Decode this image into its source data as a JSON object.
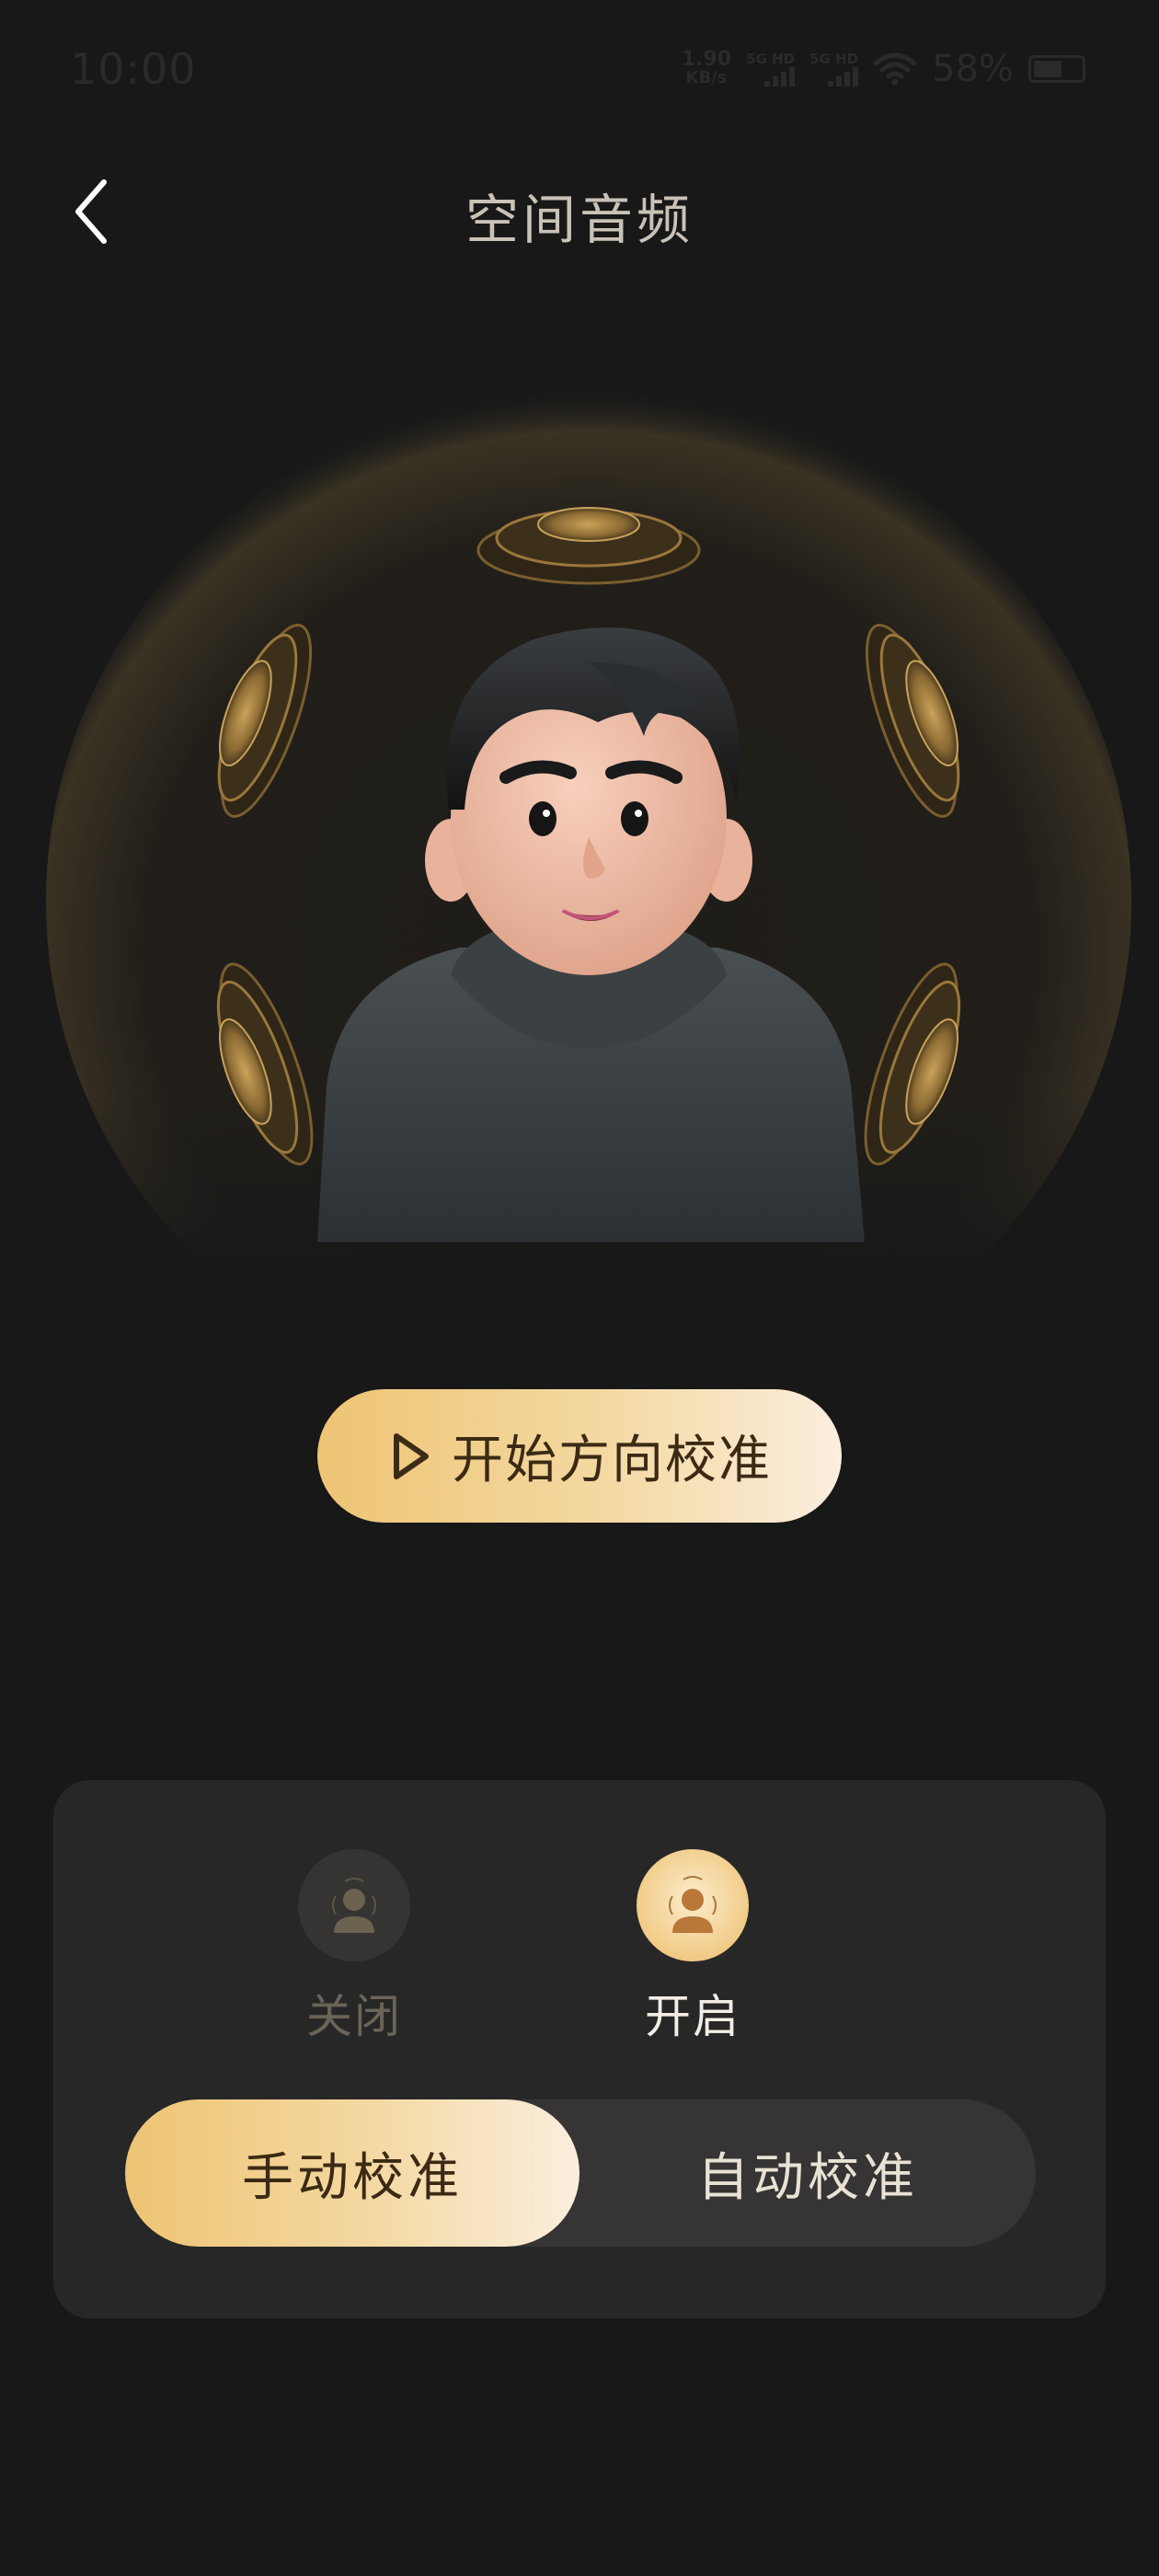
{
  "status_bar": {
    "time": "10:00",
    "net_speed_value": "1.90",
    "net_speed_unit": "KB/s",
    "signal1_label": "5G HD",
    "signal2_label": "5G HD",
    "battery_percent": "58%"
  },
  "header": {
    "title": "空间音频",
    "back_icon": "chevron-left-icon"
  },
  "hero": {
    "image": "avatar-with-surround-sound-waves"
  },
  "calibrate_button": {
    "label": "开始方向校准",
    "icon": "play-icon"
  },
  "control_panel": {
    "modes": [
      {
        "label": "关闭",
        "selected": false,
        "icon": "person-icon"
      },
      {
        "label": "开启",
        "selected": true,
        "icon": "person-sound-icon"
      }
    ],
    "calibration_modes": [
      {
        "label": "手动校准",
        "selected": true
      },
      {
        "label": "自动校准",
        "selected": false
      }
    ]
  },
  "colors": {
    "background": "#181818",
    "panel": "#272727",
    "accent_gold_start": "#eec474",
    "accent_gold_end": "#fbeede",
    "title_text": "#c9c2b6"
  }
}
